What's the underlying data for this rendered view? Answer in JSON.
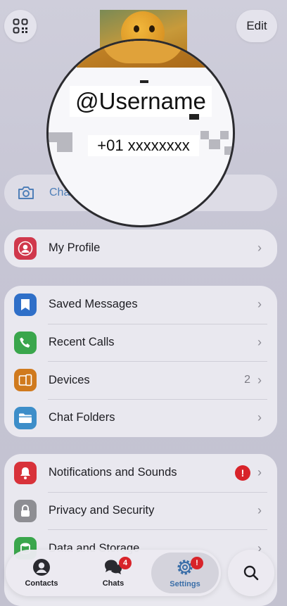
{
  "header": {
    "edit_label": "Edit",
    "username": "@Username",
    "phone": "+01 xxxxxxxx"
  },
  "photo_row": {
    "label": "Cha"
  },
  "groups": {
    "profile": {
      "my_profile": "My Profile"
    },
    "main": {
      "saved": "Saved Messages",
      "calls": "Recent Calls",
      "devices": "Devices",
      "devices_count": "2",
      "folders": "Chat Folders"
    },
    "settings": {
      "notifications": "Notifications and Sounds",
      "notifications_alert": "!",
      "privacy": "Privacy and Security",
      "data": "Data and Storage"
    }
  },
  "tabbar": {
    "contacts": "Contacts",
    "chats": "Chats",
    "chats_badge": "4",
    "settings": "Settings",
    "settings_badge": "!"
  },
  "colors": {
    "accent": "#3a6ea8",
    "my_profile_icon": "#d0384c",
    "saved_icon": "#2f6fc8",
    "calls_icon": "#3aa64c",
    "devices_icon": "#d07a1e",
    "folders_icon": "#3d8ec9",
    "notifications_icon": "#d8323a",
    "privacy_icon": "#8e8e93",
    "badge": "#d8232a"
  }
}
